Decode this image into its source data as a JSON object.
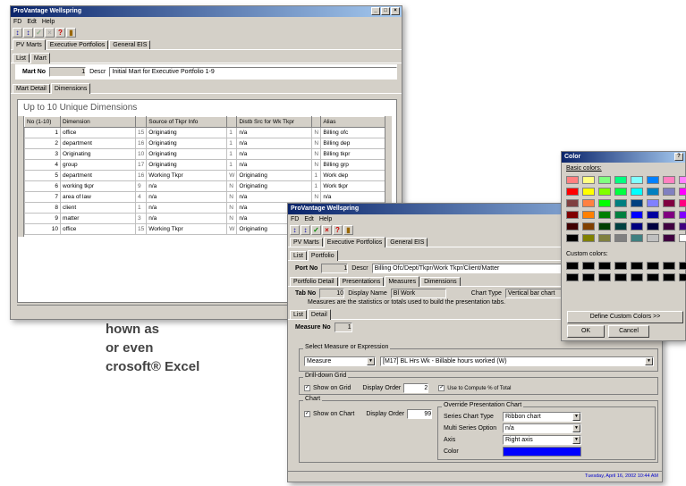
{
  "caption": {
    "l1": "hown as",
    "l2": "or even",
    "l3": "crosoft® Excel"
  },
  "w1": {
    "title": "ProVantage Wellspring",
    "menu": [
      "FD",
      "Edt",
      "Help"
    ],
    "tabs": [
      "PV Marts",
      "Executive Portfolios",
      "General EIS"
    ],
    "subtabs": [
      "List",
      "Mart"
    ],
    "mart_label": "Mart No",
    "mart_no": "1",
    "descr_label": "Descr",
    "descr": "Initial Mart for Executive Portfolio 1-9",
    "dtabs": [
      "Mart Detail",
      "Dimensions"
    ],
    "heading": "Up to 10 Unique Dimensions",
    "cols": [
      "No (1-10)",
      "Dimension",
      "Source of Tkpr Info",
      "Distb Src for Wk Tkpr",
      "Alias"
    ],
    "rows": [
      [
        "1",
        "office",
        "15",
        "Originating",
        "1",
        "n/a",
        "N",
        "Billing ofc"
      ],
      [
        "2",
        "department",
        "16",
        "Originating",
        "1",
        "n/a",
        "N",
        "Billing dep"
      ],
      [
        "3",
        "Originating",
        "10",
        "Originating",
        "1",
        "n/a",
        "N",
        "Billing tkpr"
      ],
      [
        "4",
        "group",
        "17",
        "Originating",
        "1",
        "n/a",
        "N",
        "Billing grp"
      ],
      [
        "5",
        "department",
        "16",
        "Working Tkpr",
        "W",
        "Originating",
        "1",
        "Work dep"
      ],
      [
        "6",
        "working tkpr",
        "9",
        "n/a",
        "N",
        "Originating",
        "1",
        "Work tkpr"
      ],
      [
        "7",
        "area of law",
        "4",
        "n/a",
        "N",
        "n/a",
        "N",
        "n/a"
      ],
      [
        "8",
        "client",
        "1",
        "n/a",
        "N",
        "n/a",
        "N",
        "n/a"
      ],
      [
        "9",
        "matter",
        "3",
        "n/a",
        "N",
        "n/a",
        "N",
        "n/a"
      ],
      [
        "10",
        "office",
        "15",
        "Working Tkpr",
        "W",
        "Originating",
        "1",
        "Work ofc"
      ]
    ]
  },
  "w2": {
    "title": "ProVantage Wellspring",
    "menu": [
      "FD",
      "Edt",
      "Help"
    ],
    "tabs": [
      "PV Marts",
      "Executive Portfolios",
      "General EIS"
    ],
    "subtabs": [
      "List",
      "Portfolio"
    ],
    "port_label": "Port No",
    "port_no": "1",
    "descr_label": "Descr",
    "descr": "Billing Ofc/Dept/Tkpr/Work Tkpr/Client/Matter",
    "ptabs": [
      "Portfolio Detail",
      "Presentations",
      "Measures",
      "Dimensions"
    ],
    "tab_label": "Tab No",
    "tab_no": "10",
    "disp_label": "Display Name",
    "disp": "Bl Work",
    "ct_label": "Chart Type",
    "ct": "Vertical bar chart",
    "note": "Measures are the statistics or totals used to build the presentation tabs.",
    "mtabs": [
      "List",
      "Detail"
    ],
    "mno_label": "Measure No",
    "mno": "1",
    "sel_label": "Select Measure or Expression",
    "measure": "Measure",
    "expr": "[M17] BL Hrs Wk  -  Billable hours worked (W)",
    "drill_label": "Drill-down Grid",
    "show_grid": "Show on Grid",
    "disp_order": "Display Order",
    "grid_order": "2",
    "use_total": "Use to Compute % of Total",
    "chart_label": "Chart",
    "show_chart": "Show on Chart",
    "chart_order": "99",
    "over_label": "Override Presentation Chart",
    "sct_label": "Series Chart Type",
    "sct": "Ribbon chart",
    "mso_label": "Multi Series Option",
    "mso": "n/a",
    "axis_label": "Axis",
    "axis": "Right axis",
    "color_label": "Color",
    "color_val": "#0000ff",
    "status": "Tuesday, April 16, 2002 10:44 AM"
  },
  "w3": {
    "title": "Color",
    "help": "?",
    "basic": "Basic colors:",
    "custom": "Custom colors:",
    "define": "Define Custom Colors >>",
    "ok": "OK",
    "cancel": "Cancel",
    "swatches": [
      "#ff8080",
      "#ffff80",
      "#80ff80",
      "#00ff80",
      "#80ffff",
      "#0080ff",
      "#ff80c0",
      "#ff80ff",
      "#ff0000",
      "#ffff00",
      "#80ff00",
      "#00ff40",
      "#00ffff",
      "#0080c0",
      "#8080c0",
      "#ff00ff",
      "#804040",
      "#ff8040",
      "#00ff00",
      "#008080",
      "#004080",
      "#8080ff",
      "#800040",
      "#ff0080",
      "#800000",
      "#ff8000",
      "#008000",
      "#008040",
      "#0000ff",
      "#0000a0",
      "#800080",
      "#8000ff",
      "#400000",
      "#804000",
      "#004000",
      "#004040",
      "#000080",
      "#000040",
      "#400040",
      "#400080",
      "#000000",
      "#808000",
      "#808040",
      "#808080",
      "#408080",
      "#c0c0c0",
      "#400040",
      "#ffffff"
    ]
  }
}
